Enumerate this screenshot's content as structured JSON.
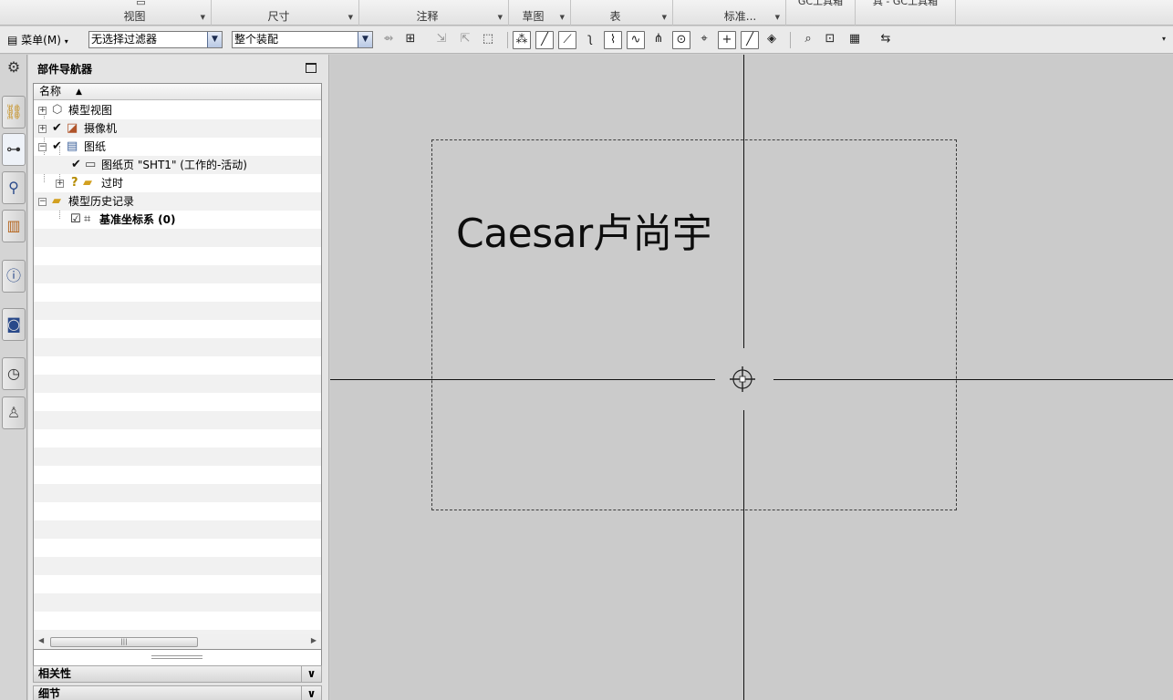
{
  "ribbon": {
    "groups": [
      {
        "label": "视图"
      },
      {
        "label": "尺寸"
      },
      {
        "label": "注释"
      },
      {
        "label": "草图"
      },
      {
        "label": "表"
      },
      {
        "label": "标准..."
      }
    ],
    "partial_tabs": [
      "GC工具箱",
      "具 - GC工具箱"
    ]
  },
  "toolbar": {
    "menu_label": "菜单(M)",
    "filter_value": "无选择过滤器",
    "assembly_value": "整个装配"
  },
  "icons": {
    "settings": "gear-icon",
    "assembly_navigator": "assembly-navigator-icon",
    "constraint_navigator": "constraint-navigator-icon",
    "part_navigator": "part-navigator-icon",
    "reuse_library": "reuse-library-icon",
    "web_browser": "info-browser-icon",
    "history": "history-clock-icon",
    "roles": "roles-icon"
  },
  "navigator": {
    "title": "部件导航器",
    "column_header": "名称",
    "items": [
      {
        "label": "模型视图"
      },
      {
        "label": "摄像机"
      },
      {
        "label": "图纸"
      },
      {
        "label": "图纸页 \"SHT1\" (工作的-活动)"
      },
      {
        "label": "过时"
      },
      {
        "label": "模型历史记录"
      },
      {
        "label": "基准坐标系 (0)"
      }
    ],
    "sections": [
      {
        "label": "相关性"
      },
      {
        "label": "细节"
      }
    ]
  },
  "canvas": {
    "note_text": "Caesar卢尚宇"
  }
}
